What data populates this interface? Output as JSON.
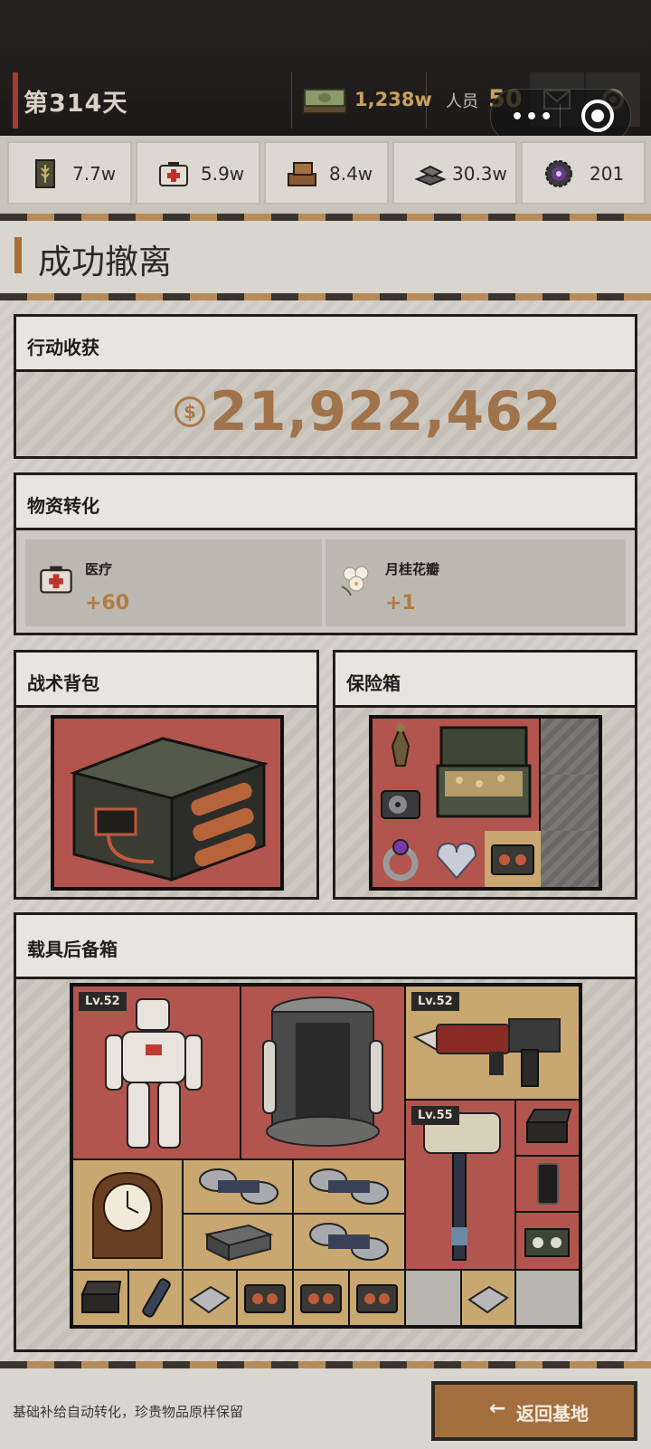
{
  "header": {
    "day_label": "第314天",
    "cash_value": "1,238w",
    "staff_label": "人员",
    "staff_value": "50"
  },
  "resources": [
    {
      "icon": "grain-icon",
      "value": "7.7w"
    },
    {
      "icon": "medkit-icon",
      "value": "5.9w"
    },
    {
      "icon": "wood-icon",
      "value": "8.4w"
    },
    {
      "icon": "steel-icon",
      "value": "30.3w"
    },
    {
      "icon": "gear-icon",
      "value": "201"
    }
  ],
  "page_title": "成功撤离",
  "earnings": {
    "title": "行动收获",
    "value": "21,922,462"
  },
  "conversion": {
    "title": "物资转化",
    "items": [
      {
        "name": "医疗",
        "amount": "+60",
        "icon": "medkit-icon"
      },
      {
        "name": "月桂花瓣",
        "amount": "+1",
        "icon": "flower-icon"
      }
    ]
  },
  "backpack": {
    "title": "战术背包",
    "item_icon": "battery-crate-icon"
  },
  "safe": {
    "title": "保险箱"
  },
  "trunk": {
    "title": "载具后备箱",
    "levels": [
      "Lv.52",
      "Lv.52",
      "Lv.55"
    ]
  },
  "footer": {
    "hint": "基础补给自动转化，珍贵物品原样保留",
    "return_label": "返回基地"
  },
  "colors": {
    "accent": "#a46f3e",
    "danger": "#b2554e",
    "gold": "#c8a870"
  }
}
